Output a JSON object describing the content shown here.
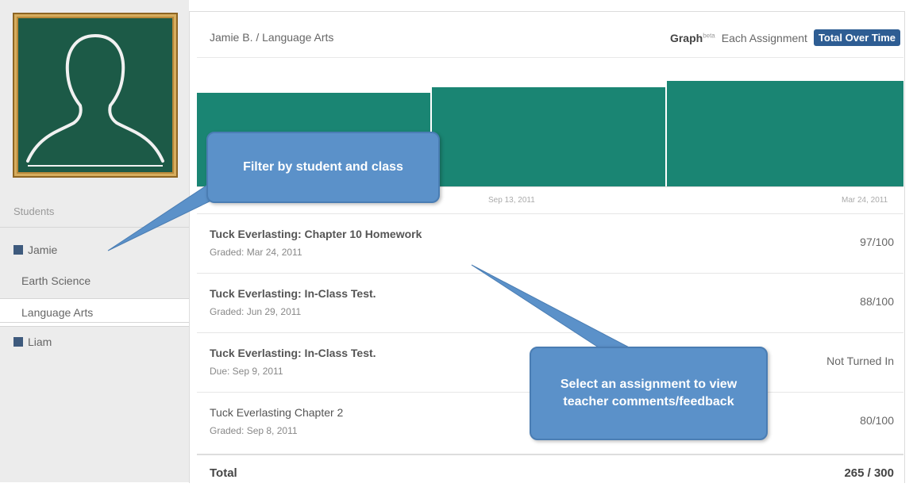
{
  "sidebar": {
    "students_label": "Students",
    "students": [
      {
        "name": "Jamie",
        "classes": [
          "Earth Science",
          "Language Arts"
        ]
      },
      {
        "name": "Liam",
        "classes": []
      }
    ],
    "selected_class": "Language Arts"
  },
  "header": {
    "breadcrumb": "Jamie B. / Language Arts",
    "graph_label": "Graph",
    "graph_badge": "beta",
    "options": [
      "Each Assignment",
      "Total Over Time"
    ],
    "active_option": "Total Over Time"
  },
  "chart_data": {
    "type": "bar",
    "color": "#1a8573",
    "x_tick_labels": [
      "Sep 13, 2011",
      "Mar 24, 2011"
    ]
  },
  "assignments": [
    {
      "title": "Tuck Everlasting: Chapter 10 Homework",
      "sub": "Graded: Mar 24, 2011",
      "score": "97/100"
    },
    {
      "title": "Tuck Everlasting: In-Class Test.",
      "sub": "Graded: Jun 29, 2011",
      "score": "88/100"
    },
    {
      "title": "Tuck Everlasting: In-Class Test.",
      "sub": "Due: Sep 9, 2011",
      "score": "Not Turned In"
    },
    {
      "title": "Tuck Everlasting Chapter 2",
      "sub": "Graded: Sep 8, 2011",
      "score": "80/100"
    }
  ],
  "total": {
    "label": "Total",
    "value": "265 / 300"
  },
  "callouts": {
    "filter": "Filter by student and class",
    "select": "Select an assignment to view teacher comments/feedback"
  },
  "colors": {
    "accent": "#2e5d93",
    "chart": "#1a8573",
    "callout": "#5b91c9",
    "chalkboard": "#1c5a47",
    "frame": "#b9893a"
  }
}
